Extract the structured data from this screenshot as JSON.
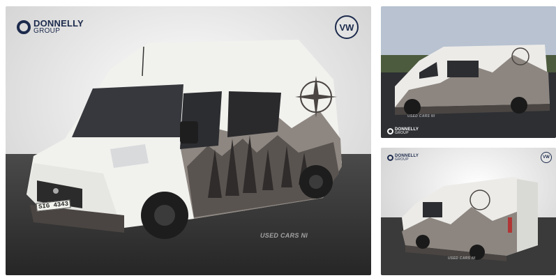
{
  "dealer": {
    "brand_line1": "DONNELLY",
    "brand_line2": "GROUP"
  },
  "manufacturer": {
    "logo_icon": "vw-logo-icon",
    "logo_text": "VW"
  },
  "watermark": {
    "text": "USED CARS NI"
  },
  "vehicle": {
    "registration_plate": "SIG 4343"
  },
  "colors": {
    "brand_navy": "#1c2a4c",
    "van_body": "#f1f1ee",
    "van_lower": "#4a4542",
    "floor": "#3a3a3a"
  }
}
